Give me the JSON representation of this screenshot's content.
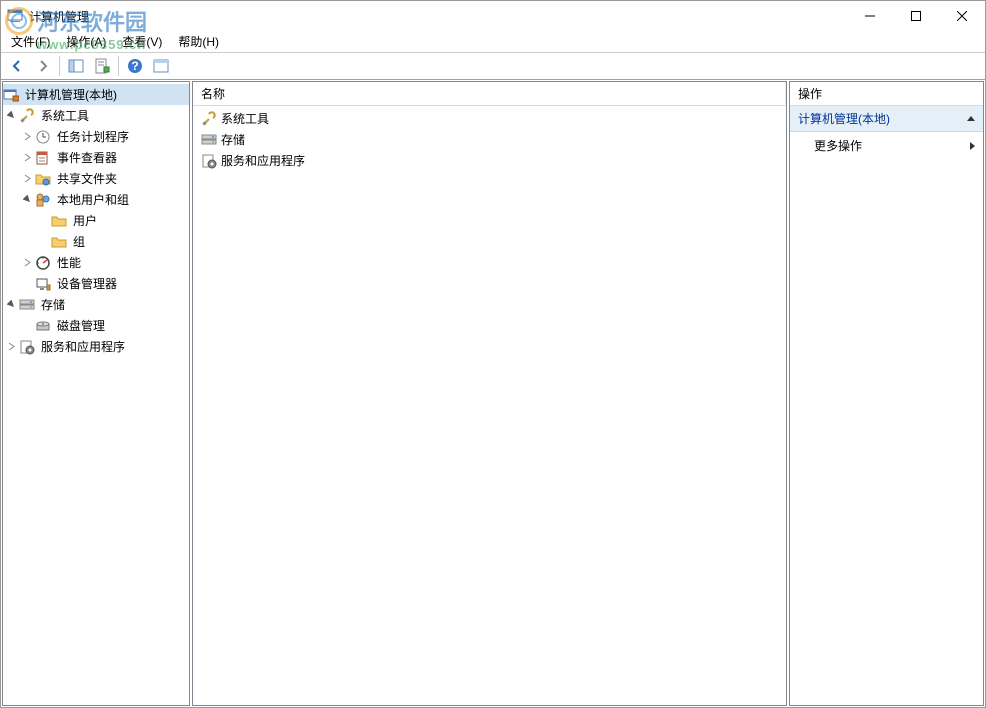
{
  "watermark": {
    "text1": "河东软件园",
    "text2": "www.pc0359.cn"
  },
  "window": {
    "title": "计算机管理"
  },
  "menu": {
    "file": "文件(F)",
    "action": "操作(A)",
    "view": "查看(V)",
    "help": "帮助(H)"
  },
  "tree": {
    "root": "计算机管理(本地)",
    "sys_tools": "系统工具",
    "task_sched": "任务计划程序",
    "event_viewer": "事件查看器",
    "shared": "共享文件夹",
    "local_users": "本地用户和组",
    "users": "用户",
    "groups": "组",
    "perf": "性能",
    "devmgr": "设备管理器",
    "storage": "存储",
    "diskmgr": "磁盘管理",
    "services_apps": "服务和应用程序"
  },
  "list": {
    "col_name": "名称",
    "items": {
      "sys_tools": "系统工具",
      "storage": "存储",
      "services_apps": "服务和应用程序"
    }
  },
  "actions": {
    "header": "操作",
    "group_title": "计算机管理(本地)",
    "more": "更多操作"
  }
}
